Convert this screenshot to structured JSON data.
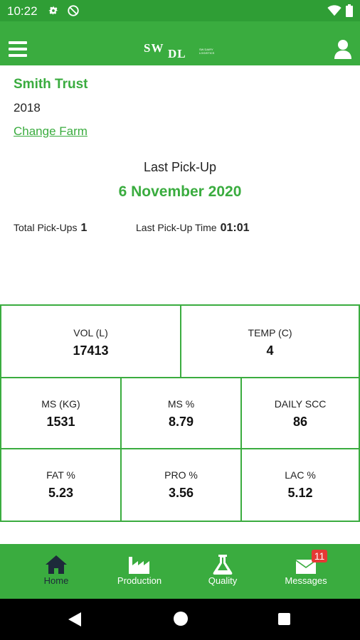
{
  "status_bar": {
    "time": "10:22"
  },
  "header": {
    "logo_main": "SW",
    "logo_sub": "DL",
    "logo_tagline": "SW Dairy Logistics"
  },
  "farm": {
    "name": "Smith Trust",
    "year": "2018",
    "change_label": "Change Farm"
  },
  "pickup": {
    "title": "Last Pick-Up",
    "date": "6 November 2020",
    "total_label": "Total Pick-Ups",
    "total_value": "1",
    "time_label": "Last Pick-Up Time",
    "time_value": "01:01"
  },
  "metrics": {
    "vol": {
      "label": "VOL (L)",
      "value": "17413"
    },
    "temp": {
      "label": "TEMP (C)",
      "value": "4"
    },
    "ms_kg": {
      "label": "MS (KG)",
      "value": "1531"
    },
    "ms_pct": {
      "label": "MS  %",
      "value": "8.79"
    },
    "scc": {
      "label": "DAILY SCC",
      "value": "86"
    },
    "fat": {
      "label": "FAT  %",
      "value": "5.23"
    },
    "pro": {
      "label": "PRO  %",
      "value": "3.56"
    },
    "lac": {
      "label": "LAC  %",
      "value": "5.12"
    }
  },
  "bottom_nav": {
    "home": "Home",
    "production": "Production",
    "quality": "Quality",
    "messages": "Messages",
    "messages_badge": "11"
  },
  "colors": {
    "primary": "#3aac3f",
    "status_bar": "#2f9e35",
    "active_nav": "#1d2a3a",
    "badge": "#e53935"
  }
}
